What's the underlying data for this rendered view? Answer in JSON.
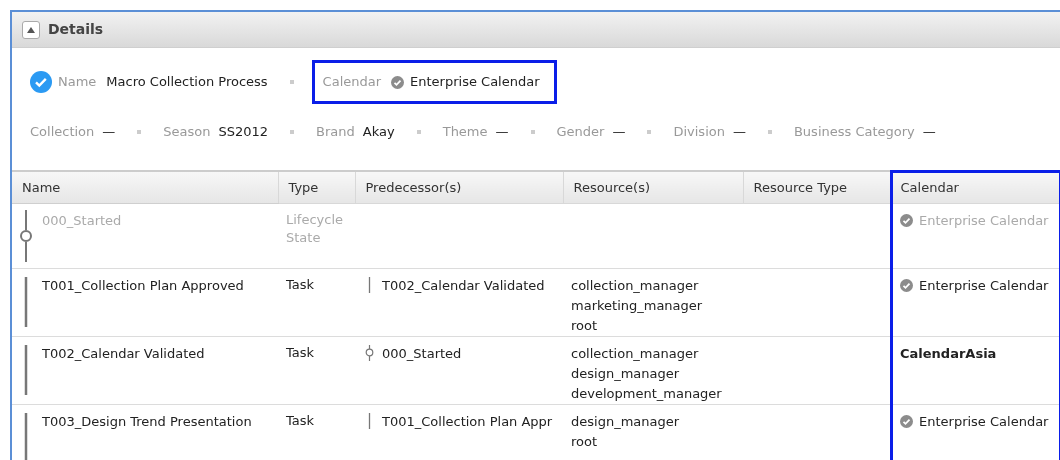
{
  "panel": {
    "title": "Details",
    "expanded": true
  },
  "summary": {
    "name_label": "Name",
    "name_value": "Macro Collection Process",
    "calendar_label": "Calendar",
    "calendar_value": "Enterprise Calendar"
  },
  "attributes": [
    {
      "label": "Collection",
      "value": "—"
    },
    {
      "label": "Season",
      "value": "SS2012"
    },
    {
      "label": "Brand",
      "value": "Akay"
    },
    {
      "label": "Theme",
      "value": "—"
    },
    {
      "label": "Gender",
      "value": "—"
    },
    {
      "label": "Division",
      "value": "—"
    },
    {
      "label": "Business Category",
      "value": "—"
    }
  ],
  "table": {
    "columns": [
      "Name",
      "Type",
      "Predecessor(s)",
      "Resource(s)",
      "Resource Type",
      "Calendar"
    ],
    "rows": [
      {
        "kind": "state",
        "name": "000_Started",
        "type": "Lifecycle State",
        "predecessor": null,
        "resources": [],
        "calendar": {
          "kind": "enterprise",
          "label": "Enterprise Calendar"
        }
      },
      {
        "kind": "task",
        "name": "T001_Collection Plan Approved",
        "type": "Task",
        "predecessor": {
          "kind": "task",
          "label": "T002_Calendar Validated"
        },
        "resources": [
          "collection_manager",
          "marketing_manager",
          "root"
        ],
        "calendar": {
          "kind": "enterprise",
          "label": "Enterprise Calendar"
        }
      },
      {
        "kind": "task",
        "name": "T002_Calendar Validated",
        "type": "Task",
        "predecessor": {
          "kind": "state",
          "label": "000_Started"
        },
        "resources": [
          "collection_manager",
          "design_manager",
          "development_manager"
        ],
        "calendar": {
          "kind": "custom",
          "label": "CalendarAsia"
        }
      },
      {
        "kind": "task",
        "name": "T003_Design Trend Presentation",
        "type": "Task",
        "predecessor": {
          "kind": "task",
          "label": "T001_Collection Plan Appr"
        },
        "resources": [
          "design_manager",
          "root"
        ],
        "calendar": {
          "kind": "enterprise",
          "label": "Enterprise Calendar"
        }
      }
    ]
  }
}
